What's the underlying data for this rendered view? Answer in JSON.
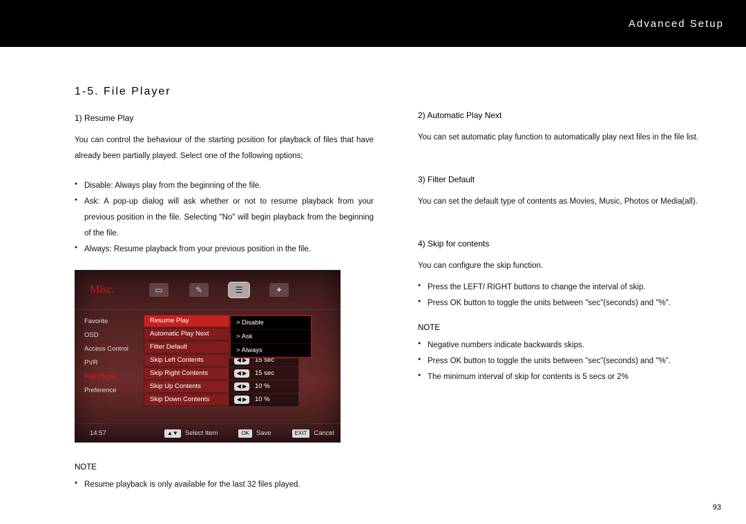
{
  "header": {
    "title": "Advanced Setup"
  },
  "title": "1-5. File Player",
  "left": {
    "s1_head": "1) Resume Play",
    "s1_para": "You can control the behaviour of the starting position for playback of files that have already been partially played.  Select one of the following options;",
    "s1_bul": [
      "Disable: Always play from the beginning of the file.",
      "Ask: A pop-up dialog will ask whether or not to resume playback from your previous position in the file.  Selecting \"No\" will begin playback from the beginning of the file.",
      "Always: Resume playback from your previous position in the file."
    ],
    "note_label": "NOTE",
    "note_bul": [
      "Resume playback is only available for the last 32 files played."
    ]
  },
  "right": {
    "s2_head": "2) Automatic Play Next",
    "s2_para": "You can set automatic play function to automatically play next files in the file list.",
    "s3_head": "3) Filter Default",
    "s3_para": "You can set the default type of contents as Movies, Music, Photos or Media(all).",
    "s4_head": "4) Skip for contents",
    "s4_para": "You can configure the skip function.",
    "s4_bul": [
      "Press the LEFT/ RIGHT buttons to change the interval of skip.",
      "Press OK button to toggle the units between \"sec\"(seconds) and \"%\"."
    ],
    "note_label": "NOTE",
    "note_bul": [
      "Negative numbers indicate backwards skips.",
      "Press OK button to toggle the units between \"sec\"(seconds) and \"%\".",
      "The minimum interval of skip for contents is 5 secs or 2%"
    ]
  },
  "screenshot": {
    "misc": "Misc.",
    "left_menu": [
      "Favorite",
      "OSD",
      "Access Control",
      "PVR",
      "File Player",
      "Preference"
    ],
    "active_left": "File Player",
    "rows": [
      {
        "key": "Resume Play",
        "val": "Disable",
        "type": "arrow",
        "hi": true
      },
      {
        "key": "Automatic Play Next",
        "val": "Ask",
        "type": "arrow"
      },
      {
        "key": "Filter Default",
        "val": "Always",
        "type": "arrow"
      },
      {
        "key": "Skip Left Contents",
        "val": "15 sec",
        "type": "lr"
      },
      {
        "key": "Skip Right Contents",
        "val": "15 sec",
        "type": "lr"
      },
      {
        "key": "Skip Up Contents",
        "val": "10 %",
        "type": "lr"
      },
      {
        "key": "Skip Down Contents",
        "val": "10 %",
        "type": "lr"
      }
    ],
    "dropdown": [
      "Disable",
      "Ask",
      "Always"
    ],
    "footer": {
      "time": "14:57",
      "h1k": "▲▼",
      "h1": "Select Item",
      "h2k": "OK",
      "h2": "Save",
      "h3k": "EXIT",
      "h3": "Cancel"
    }
  },
  "page_number": "93"
}
